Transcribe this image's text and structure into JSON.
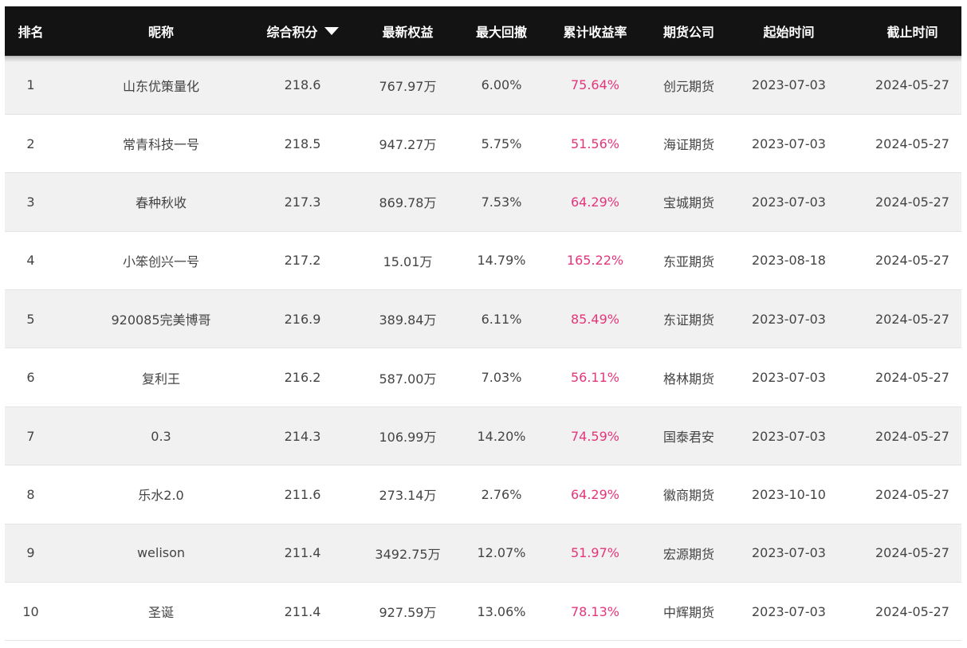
{
  "table": {
    "columns": {
      "rank": "排名",
      "nickname": "昵称",
      "score": "综合积分",
      "equity": "最新权益",
      "max_drawdown": "最大回撤",
      "cum_return": "累计收益率",
      "broker": "期货公司",
      "start": "起始时间",
      "end": "截止时间"
    },
    "sort": {
      "column": "score",
      "direction": "descending",
      "icon": "sort-down-icon"
    },
    "colors": {
      "header_bg": "#131313",
      "return_text": "#e5357a",
      "row_alt_bg": "#f1f1f1"
    },
    "rows": [
      {
        "rank": "1",
        "nickname": "山东优策量化",
        "score": "218.6",
        "equity": "767.97万",
        "max_drawdown": "6.00%",
        "cum_return": "75.64%",
        "broker": "创元期货",
        "start": "2023-07-03",
        "end": "2024-05-27"
      },
      {
        "rank": "2",
        "nickname": "常青科技一号",
        "score": "218.5",
        "equity": "947.27万",
        "max_drawdown": "5.75%",
        "cum_return": "51.56%",
        "broker": "海证期货",
        "start": "2023-07-03",
        "end": "2024-05-27"
      },
      {
        "rank": "3",
        "nickname": "春种秋收",
        "score": "217.3",
        "equity": "869.78万",
        "max_drawdown": "7.53%",
        "cum_return": "64.29%",
        "broker": "宝城期货",
        "start": "2023-07-03",
        "end": "2024-05-27"
      },
      {
        "rank": "4",
        "nickname": "小笨创兴一号",
        "score": "217.2",
        "equity": "15.01万",
        "max_drawdown": "14.79%",
        "cum_return": "165.22%",
        "broker": "东亚期货",
        "start": "2023-08-18",
        "end": "2024-05-27"
      },
      {
        "rank": "5",
        "nickname": "920085完美博哥",
        "score": "216.9",
        "equity": "389.84万",
        "max_drawdown": "6.11%",
        "cum_return": "85.49%",
        "broker": "东证期货",
        "start": "2023-07-03",
        "end": "2024-05-27"
      },
      {
        "rank": "6",
        "nickname": "复利王",
        "score": "216.2",
        "equity": "587.00万",
        "max_drawdown": "7.03%",
        "cum_return": "56.11%",
        "broker": "格林期货",
        "start": "2023-07-03",
        "end": "2024-05-27"
      },
      {
        "rank": "7",
        "nickname": "0.3",
        "score": "214.3",
        "equity": "106.99万",
        "max_drawdown": "14.20%",
        "cum_return": "74.59%",
        "broker": "国泰君安",
        "start": "2023-07-03",
        "end": "2024-05-27"
      },
      {
        "rank": "8",
        "nickname": "乐水2.0",
        "score": "211.6",
        "equity": "273.14万",
        "max_drawdown": "2.76%",
        "cum_return": "64.29%",
        "broker": "徽商期货",
        "start": "2023-10-10",
        "end": "2024-05-27"
      },
      {
        "rank": "9",
        "nickname": "welison",
        "score": "211.4",
        "equity": "3492.75万",
        "max_drawdown": "12.07%",
        "cum_return": "51.97%",
        "broker": "宏源期货",
        "start": "2023-07-03",
        "end": "2024-05-27"
      },
      {
        "rank": "10",
        "nickname": "圣诞",
        "score": "211.4",
        "equity": "927.59万",
        "max_drawdown": "13.06%",
        "cum_return": "78.13%",
        "broker": "中辉期货",
        "start": "2023-07-03",
        "end": "2024-05-27"
      }
    ]
  }
}
